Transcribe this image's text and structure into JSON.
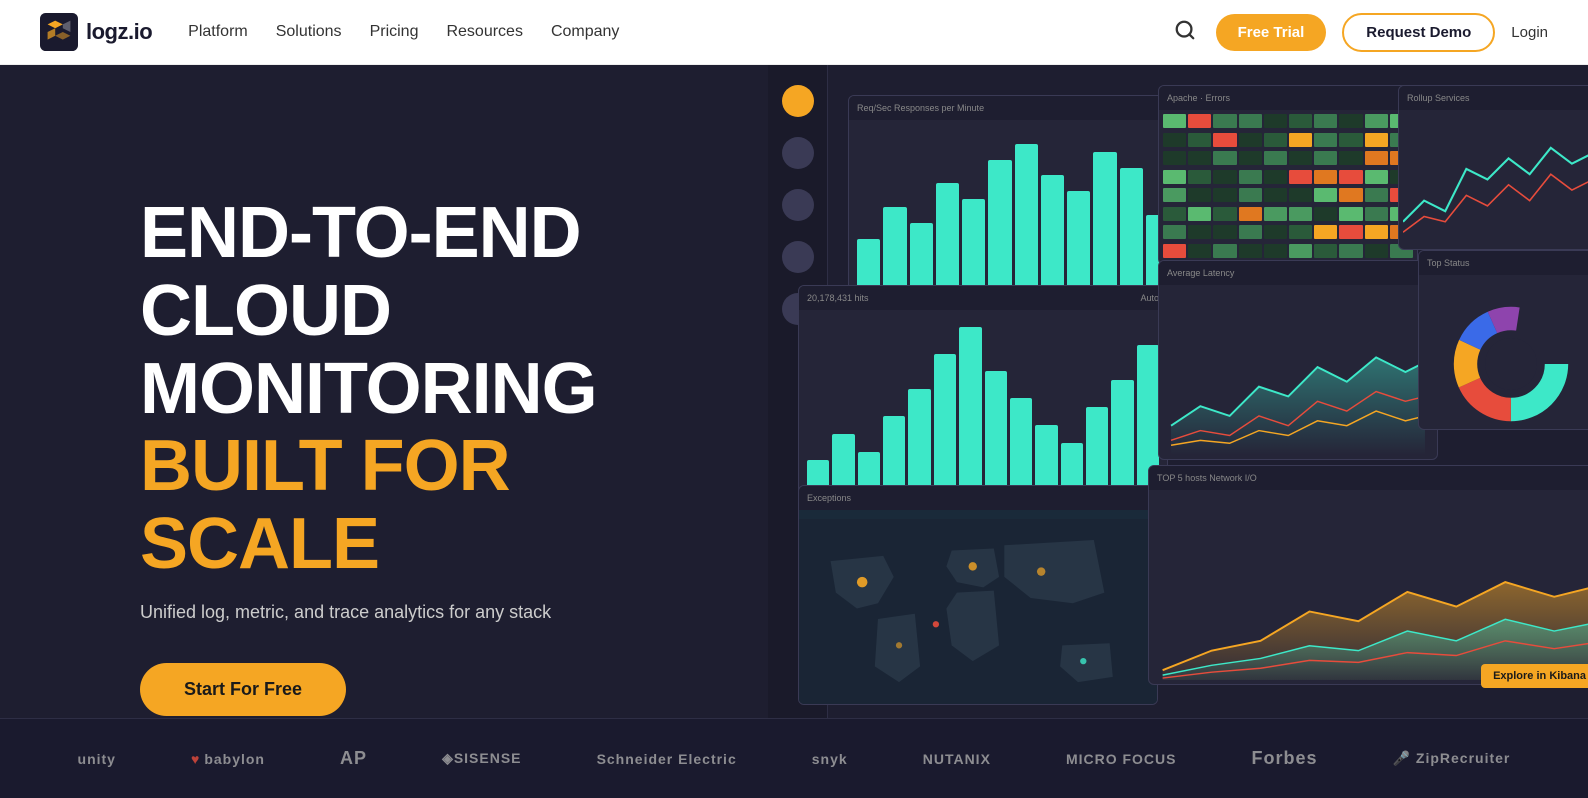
{
  "navbar": {
    "logo_text": "logz.io",
    "nav_items": [
      {
        "label": "Platform",
        "id": "platform"
      },
      {
        "label": "Solutions",
        "id": "solutions"
      },
      {
        "label": "Pricing",
        "id": "pricing"
      },
      {
        "label": "Resources",
        "id": "resources"
      },
      {
        "label": "Company",
        "id": "company"
      }
    ],
    "btn_free_trial": "Free Trial",
    "btn_request_demo": "Request Demo",
    "btn_login": "Login"
  },
  "hero": {
    "title_line1": "END-TO-END",
    "title_line2": "CLOUD",
    "title_line3": "MONITORING",
    "title_line4": "BUILT FOR SCALE",
    "subtitle": "Unified log, metric, and trace analytics for any stack",
    "cta_button": "Start For Free"
  },
  "logos_bar": {
    "items": [
      {
        "label": "unity",
        "style": "normal"
      },
      {
        "label": "♥ babylon",
        "style": "heart"
      },
      {
        "label": "AP",
        "style": "bold"
      },
      {
        "label": "◈SISENSE",
        "style": "normal"
      },
      {
        "label": "Schneider Electric",
        "style": "normal"
      },
      {
        "label": "snyk",
        "style": "normal"
      },
      {
        "label": "NUTANIX",
        "style": "normal"
      },
      {
        "label": "MICRO FOCUS",
        "style": "normal"
      },
      {
        "label": "Forbes",
        "style": "bold"
      },
      {
        "label": "ZipRecruiter",
        "style": "normal"
      }
    ]
  },
  "icons": {
    "search": "🔍",
    "logo_shape": "📦"
  }
}
